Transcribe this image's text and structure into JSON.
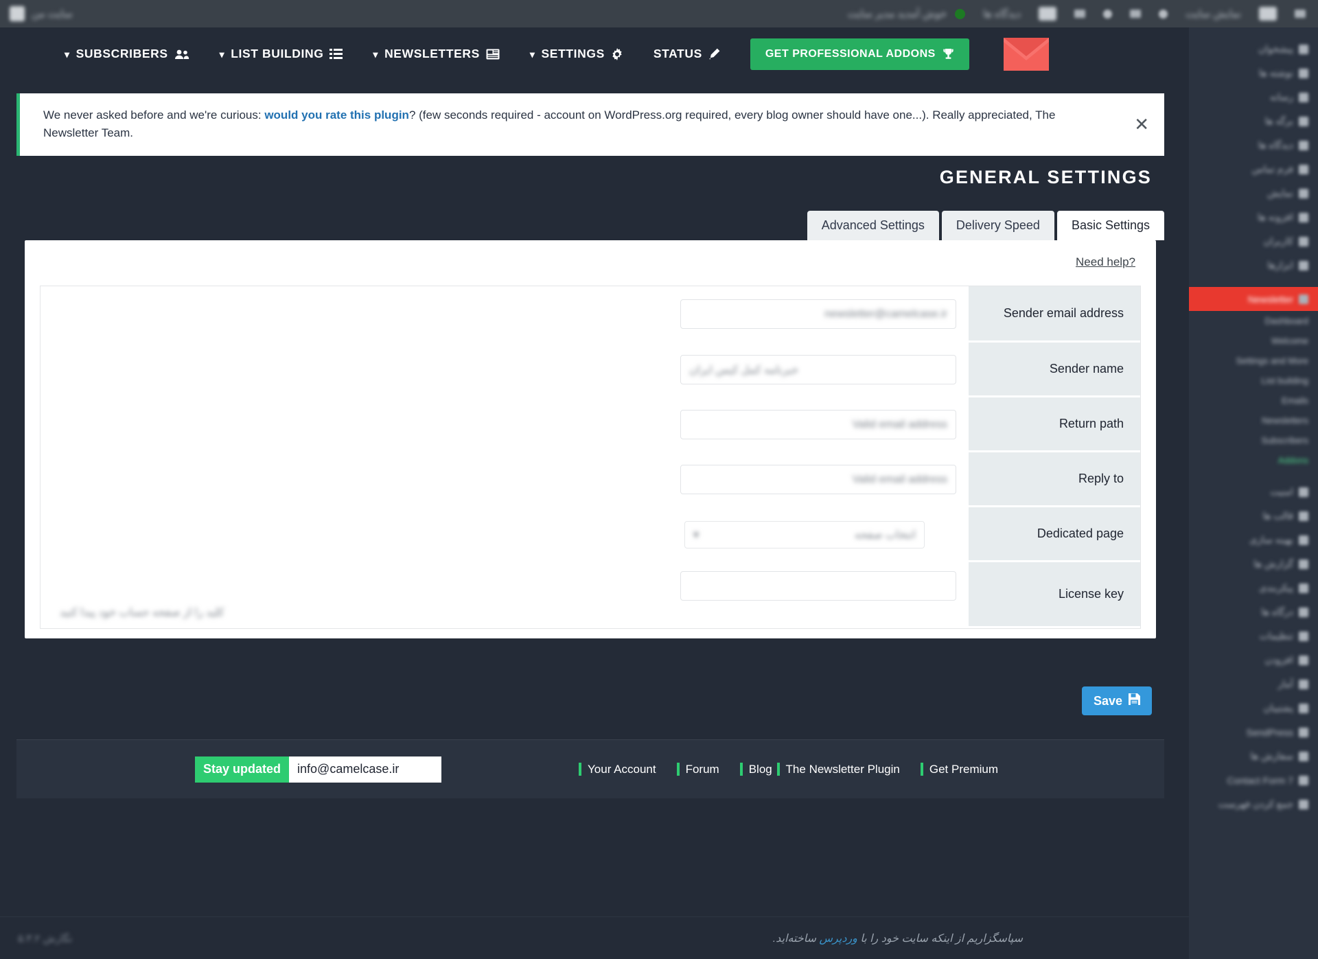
{
  "adminbar": {
    "site_name_redacted": "سایت من",
    "right_items_redacted": [
      "خوش آمدید مدیر سایت",
      "دیدگاه ها",
      "جدید",
      "نمایش سایت"
    ],
    "status_dot_color": "#1d7a23"
  },
  "nav": {
    "items": [
      {
        "label": "SUBSCRIBERS",
        "icon": "users-icon",
        "chevron": "chevron-down-icon"
      },
      {
        "label": "LIST BUILDING",
        "icon": "list-icon",
        "chevron": "chevron-down-icon"
      },
      {
        "label": "NEWSLETTERS",
        "icon": "newsletter-icon",
        "chevron": "chevron-down-icon"
      },
      {
        "label": "SETTINGS",
        "icon": "gear-icon",
        "chevron": "chevron-down-icon"
      },
      {
        "label": "STATUS",
        "icon": "pencil-icon",
        "chevron": ""
      }
    ],
    "addons_button": {
      "label": "GET PROFESSIONAL ADDONS",
      "icon": "trophy-icon",
      "color": "#27ae60"
    },
    "logo": {
      "name": "newsletter-envelope-logo",
      "color": "#f4605a"
    }
  },
  "notice": {
    "text_before_link": "We never asked before and we're curious: ",
    "link_text": "would you rate this plugin",
    "text_after_link": "? (few seconds required - account on WordPress.org required, every blog owner should have one...). Really appreciated, The Newsletter Team.",
    "accent_color": "#2bb673",
    "close_label": "✕"
  },
  "page": {
    "title": "GENERAL SETTINGS"
  },
  "tabs": [
    {
      "label": "Basic Settings",
      "active": true
    },
    {
      "label": "Delivery Speed",
      "active": false
    },
    {
      "label": "Advanced Settings",
      "active": false
    }
  ],
  "card": {
    "need_help": "?Need help"
  },
  "form": {
    "rows": [
      {
        "label": "Sender email address",
        "value_redacted": "newsletter@camelcase.ir",
        "type": "text",
        "hint": ""
      },
      {
        "label": "Sender name",
        "value_redacted": "خبرنامه کمل کیس ایران",
        "type": "text-rtl",
        "hint": ""
      },
      {
        "label": "Return path",
        "value_redacted": "Valid email address",
        "type": "text",
        "hint": ""
      },
      {
        "label": "Reply to",
        "value_redacted": "Valid email address",
        "type": "text",
        "hint": ""
      },
      {
        "label": "Dedicated page",
        "value_redacted": "انتخاب صفحه",
        "type": "select",
        "hint": ""
      },
      {
        "label": "License key",
        "value_redacted": "",
        "type": "text",
        "hint": "کلید را از صفحه حساب خود پیدا کنید"
      }
    ]
  },
  "actions": {
    "save_label": "Save",
    "save_icon": "floppy-disk-icon",
    "save_color": "#3498db"
  },
  "footer": {
    "stay_updated_label": "Stay updated",
    "email_value": "info@camelcase.ir",
    "left_links": [
      "Your Account",
      "Forum",
      "Blog"
    ],
    "right_links": [
      "The Newsletter Plugin",
      "Get Premium"
    ],
    "accent_color": "#2ecc71"
  },
  "wp_footer": {
    "version_redacted": "نگارش ۵.۳.۲",
    "thanks_before": "سپاسگزاریم از اینکه سایت خود را با ",
    "thanks_link": "وردپرس",
    "thanks_after": " ساخته‌اید."
  },
  "sidebar": {
    "items": [
      {
        "label": "پیشخوان",
        "current": false,
        "sub": false
      },
      {
        "label": "نوشته ها",
        "current": false,
        "sub": false
      },
      {
        "label": "رسانه",
        "current": false,
        "sub": false
      },
      {
        "label": "برگه ها",
        "current": false,
        "sub": false
      },
      {
        "label": "دیدگاه ها",
        "current": false,
        "sub": false
      },
      {
        "label": "فرم تماس",
        "current": false,
        "sub": false
      },
      {
        "label": "نمایش",
        "current": false,
        "sub": false
      },
      {
        "label": "افزونه ها",
        "current": false,
        "sub": false
      },
      {
        "label": "کاربران",
        "current": false,
        "sub": false
      },
      {
        "label": "ابزارها",
        "current": false,
        "sub": false
      },
      {
        "label": "Newsletter",
        "current": true,
        "sub": false
      },
      {
        "label": "Dashboard",
        "current": false,
        "sub": true
      },
      {
        "label": "Welcome",
        "current": false,
        "sub": true
      },
      {
        "label": "Settings and More",
        "current": false,
        "sub": true
      },
      {
        "label": "List building",
        "current": false,
        "sub": true
      },
      {
        "label": "Emails",
        "current": false,
        "sub": true
      },
      {
        "label": "Newsletters",
        "current": false,
        "sub": true
      },
      {
        "label": "Subscribers",
        "current": false,
        "sub": true
      },
      {
        "label": "Addons",
        "current": false,
        "sub": true,
        "green": true
      },
      {
        "label": "امنیت",
        "current": false,
        "sub": false
      },
      {
        "label": "قالب ها",
        "current": false,
        "sub": false
      },
      {
        "label": "بهینه سازی",
        "current": false,
        "sub": false
      },
      {
        "label": "گزارش ها",
        "current": false,
        "sub": false
      },
      {
        "label": "پیکربندی",
        "current": false,
        "sub": false
      },
      {
        "label": "درگاه ها",
        "current": false,
        "sub": false
      },
      {
        "label": "تنظیمات",
        "current": false,
        "sub": false
      },
      {
        "label": "افزودن",
        "current": false,
        "sub": false
      },
      {
        "label": "آمار",
        "current": false,
        "sub": false
      },
      {
        "label": "پشتیبان",
        "current": false,
        "sub": false
      },
      {
        "label": "SendPress",
        "current": false,
        "sub": false
      },
      {
        "label": "سفارش ها",
        "current": false,
        "sub": false
      },
      {
        "label": "Contact Form 7",
        "current": false,
        "sub": false
      },
      {
        "label": "جمع کردن فهرست",
        "current": false,
        "sub": false
      }
    ]
  }
}
